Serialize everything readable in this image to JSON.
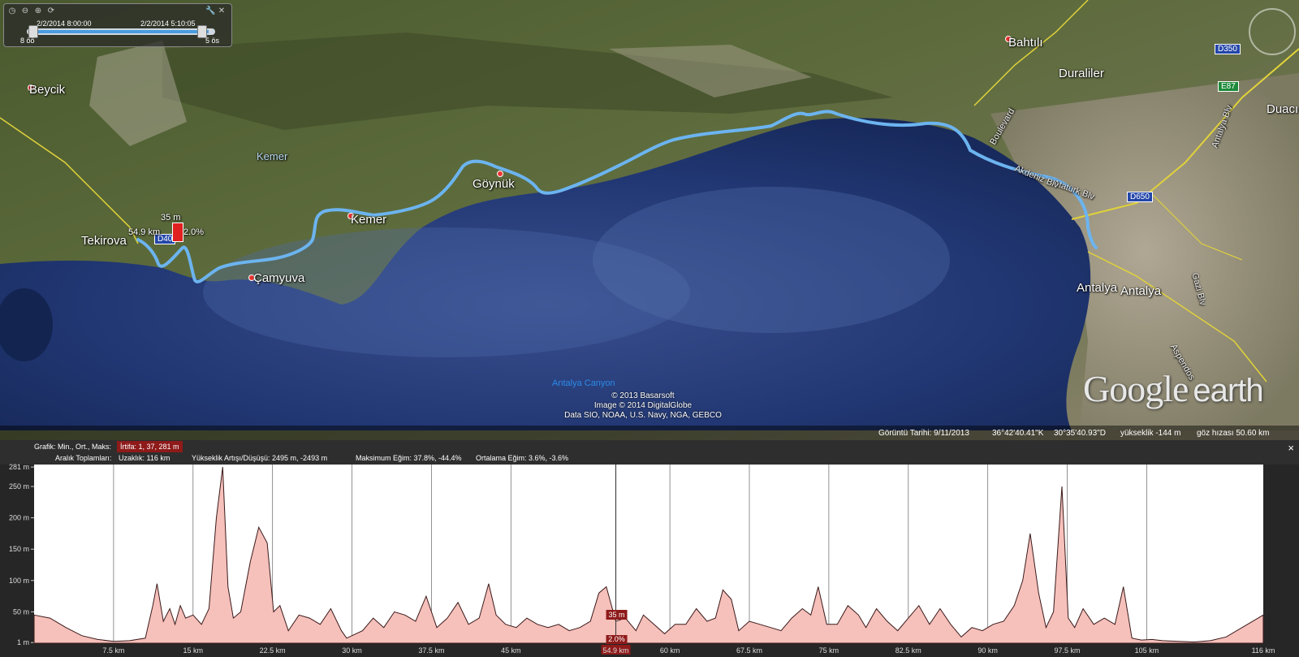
{
  "map": {
    "places": {
      "beycik": "Beycik",
      "kemer_mtn": "Kemer",
      "tekirova": "Tekirova",
      "camyuva": "Çamyuva",
      "kemer": "Kemer",
      "goynuk": "Göynük",
      "bahtili": "Bahtılı",
      "duraliler": "Duraliler",
      "duaci": "Duacı",
      "antalya_1": "Antalya",
      "antalya_2": "Antalya",
      "canyon": "Antalya Canyon"
    },
    "roads": {
      "d350": "D350",
      "e87": "E87",
      "d650": "D650",
      "d400": "D40",
      "ataturk": "Atatürk Blv",
      "akdeniz": "Akdeniz Blv",
      "boulevard_2": "Boulevard",
      "gazi": "Gazi Blv",
      "aspendos": "Aspendos",
      "antalya_blv": "Antalya Blv"
    },
    "marker": {
      "elevation": "35 m",
      "distance": "54.9 km",
      "grade": "2.0%"
    },
    "copyright": [
      "© 2013 Basarsoft",
      "Image © 2014 DigitalGlobe",
      "Data SIO, NOAA, U.S. Navy, NGA, GEBCO"
    ],
    "logo_main": "Google",
    "logo_sub": "earth"
  },
  "tour": {
    "start_label": "2/2/2014   8:00:00",
    "end_label": "2/2/2014   5:10:05",
    "min_label": "8 öö",
    "max_label": "5 ös"
  },
  "status": {
    "date": "Görüntü Tarihi: 9/11/2013",
    "lat": "36°42'40.41\"K",
    "lon": "30°35'40.93\"D",
    "elev": "yükseklik  -144 m",
    "eye": "göz hızası   50.60 km"
  },
  "elevation_panel": {
    "row1_label": "Grafik: Min., Ort., Maks:",
    "row1_value": "İrtifa: 1, 37, 281 m",
    "row2_label": "Aralık Toplamları:",
    "distance": "Uzaklık: 116 km",
    "gain_loss": "Yükseklik Artışı/Düşüşü: 2495 m, -2493 m",
    "max_slope": "Maksimum Eğim: 37.8%, -44.4%",
    "avg_slope": "Ortalama Eğim: 3.6%, -3.6%",
    "close": "×",
    "cursor_elev": "35 m",
    "cursor_grade": "2.0%",
    "cursor_dist": "54.9 km"
  },
  "chart_data": {
    "type": "area",
    "y_ticks": [
      "281 m",
      "250 m",
      "200 m",
      "150 m",
      "100 m",
      "50 m",
      "1 m"
    ],
    "x_ticks": [
      "7.5 km",
      "15 km",
      "22.5 km",
      "30 km",
      "37.5 km",
      "45 km",
      "54.9 km",
      "60 km",
      "67.5 km",
      "75 km",
      "82.5 km",
      "90 km",
      "97.5 km",
      "105 km",
      "116 km"
    ],
    "ylim": [
      0,
      285
    ],
    "xlim": [
      0,
      116
    ],
    "colors": {
      "fill": "#f6c0bb",
      "line": "#3a1a1a",
      "route": "#6cb4f0"
    },
    "x": [
      0,
      1.5,
      3,
      4.5,
      6,
      7.5,
      9,
      10.5,
      11.2,
      11.6,
      12.2,
      12.8,
      13.3,
      13.8,
      14.3,
      15,
      15.8,
      16.5,
      17.2,
      17.8,
      18.3,
      18.8,
      19.5,
      20.4,
      21.2,
      22,
      22.6,
      23.2,
      24,
      25,
      26,
      27,
      28,
      29,
      29.5,
      30,
      31,
      32,
      33,
      34,
      35,
      36,
      37,
      38,
      39,
      40,
      41,
      42,
      42.9,
      43.6,
      44.5,
      45.5,
      46.5,
      47.5,
      48.5,
      49.5,
      50.5,
      51.5,
      52.5,
      53.3,
      54,
      54.9,
      55.8,
      56.8,
      57.5,
      58.5,
      59.5,
      60.5,
      61.5,
      62.5,
      63.5,
      64.3,
      65,
      65.8,
      66.5,
      67.5,
      68.5,
      69.5,
      70.5,
      71.5,
      72.5,
      73.3,
      74,
      74.8,
      75.8,
      76.8,
      77.8,
      78.5,
      79.5,
      80.5,
      81.5,
      82.5,
      83.5,
      84.5,
      85.5,
      86.5,
      87.5,
      88.5,
      89.5,
      90.5,
      91.5,
      92.5,
      93.3,
      94,
      94.8,
      95.5,
      96.2,
      97,
      97.6,
      98.2,
      99,
      100,
      101,
      102,
      102.8,
      103.6,
      104.5,
      105.5,
      106.5,
      108,
      109.5,
      111,
      112.5,
      114,
      116
    ],
    "y": [
      45,
      40,
      25,
      12,
      6,
      3,
      4,
      8,
      60,
      95,
      35,
      55,
      30,
      60,
      40,
      45,
      30,
      55,
      200,
      281,
      90,
      40,
      50,
      130,
      185,
      160,
      50,
      60,
      20,
      45,
      40,
      30,
      55,
      20,
      8,
      12,
      20,
      40,
      25,
      50,
      45,
      35,
      75,
      25,
      40,
      65,
      30,
      40,
      95,
      45,
      30,
      25,
      40,
      30,
      25,
      30,
      20,
      25,
      35,
      80,
      90,
      35,
      40,
      20,
      45,
      30,
      15,
      30,
      30,
      55,
      35,
      40,
      85,
      70,
      20,
      35,
      30,
      25,
      20,
      40,
      55,
      45,
      90,
      30,
      30,
      60,
      45,
      25,
      55,
      35,
      20,
      40,
      60,
      30,
      55,
      30,
      10,
      25,
      20,
      30,
      35,
      60,
      100,
      175,
      80,
      25,
      50,
      250,
      40,
      25,
      55,
      30,
      40,
      30,
      90,
      8,
      5,
      6,
      4,
      3,
      2,
      4,
      10,
      25,
      45
    ]
  }
}
